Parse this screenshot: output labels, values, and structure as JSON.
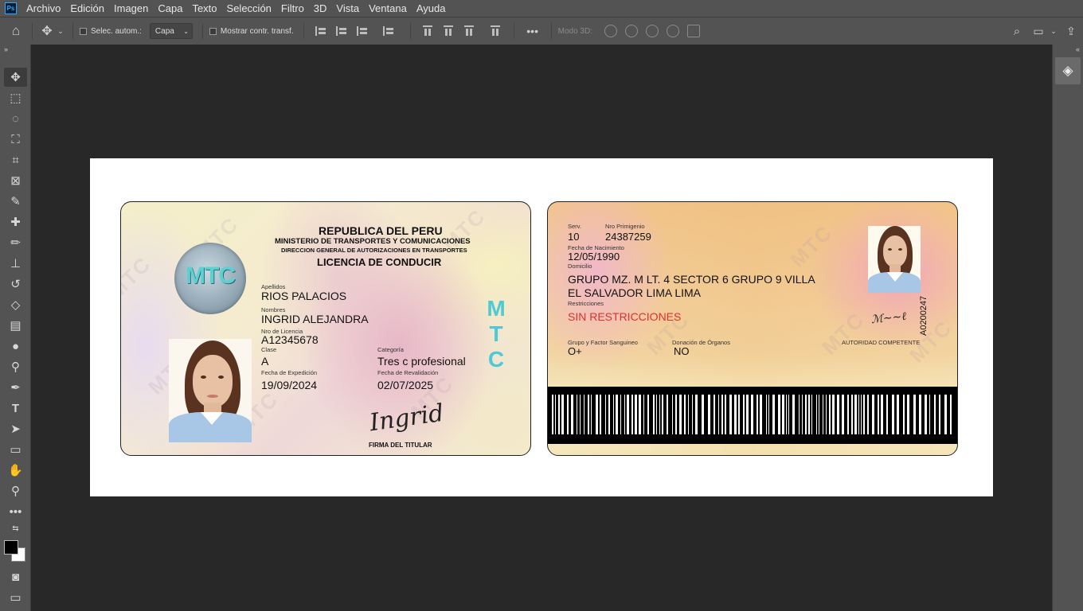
{
  "app": {
    "menu": [
      "Archivo",
      "Edición",
      "Imagen",
      "Capa",
      "Texto",
      "Selección",
      "Filtro",
      "3D",
      "Vista",
      "Ventana",
      "Ayuda"
    ],
    "logo": "Ps"
  },
  "options": {
    "auto_select_label": "Selec. autom.:",
    "auto_select_target": "Capa",
    "show_transform_label": "Mostrar contr. transf.",
    "mode3d_label": "Modo 3D:"
  },
  "front": {
    "country": "REPUBLICA DEL PERU",
    "ministry": "MINISTERIO DE TRANSPORTES Y COMUNICACIONES",
    "directorate": "DIRECCION GENERAL DE AUTORIZACIONES EN TRANSPORTES",
    "doc_title": "LICENCIA DE CONDUCIR",
    "seal_text": "MTC",
    "vertical_brand": [
      "M",
      "T",
      "C"
    ],
    "apellidos_label": "Apellidos",
    "apellidos": "RIOS PALACIOS",
    "nombres_label": "Nombres",
    "nombres": "INGRID ALEJANDRA",
    "licencia_label": "Nro de Licencia",
    "licencia": "A12345678",
    "clase_label": "Clase",
    "clase": "A",
    "categoria_label": "Categoría",
    "categoria": "Tres c profesional",
    "expedicion_label": "Fecha de Expedición",
    "expedicion": "19/09/2024",
    "revalidacion_label": "Fecha de Revalidación",
    "revalidacion": "02/07/2025",
    "signature": "Ingrid",
    "firma_label": "FIRMA DEL TITULAR",
    "watermark": "MTC"
  },
  "back": {
    "serv_label": "Serv.",
    "serv": "10",
    "primigenio_label": "Nro Primigenio",
    "primigenio": "24387259",
    "nacimiento_label": "Fecha de Nacimiento",
    "nacimiento": "12/05/1990",
    "domicilio_label": "Domicilio",
    "domicilio_1": "GRUPO MZ. M LT. 4 SECTOR 6 GRUPO 9 VILLA",
    "domicilio_2": "EL SALVADOR LIMA LIMA",
    "restricciones_label": "Restricciones",
    "restricciones": "SIN RESTRICCIONES",
    "sangre_label": "Grupo y Factor Sanguineo",
    "sangre": "O+",
    "donacion_label": "Donación de Órganos",
    "donacion": "NO",
    "autoridad": "AUTORIDAD COMPETENTE",
    "serial": "A0200247",
    "colors": {
      "restriction_red": "#e03030"
    }
  }
}
